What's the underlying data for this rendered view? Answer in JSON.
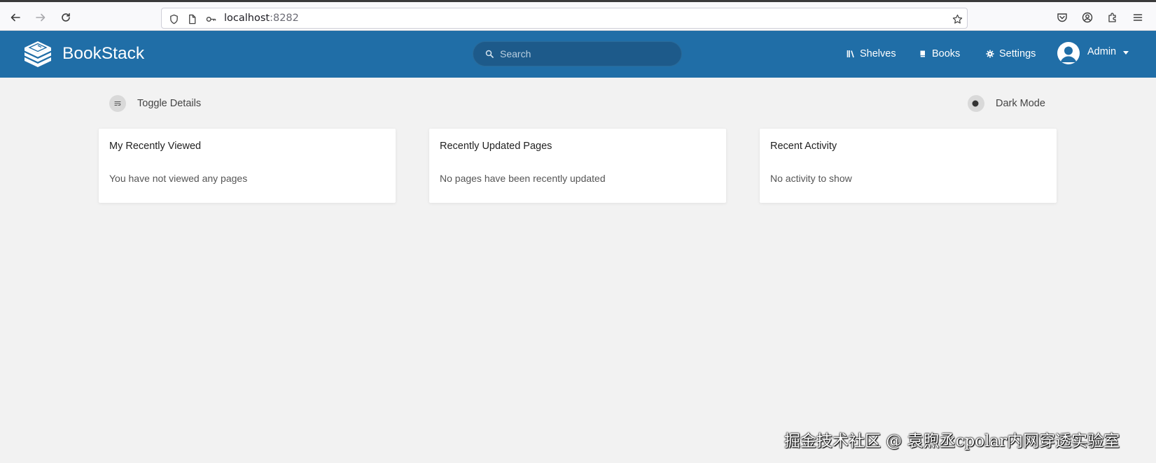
{
  "browser": {
    "url_host": "localhost",
    "url_port": ":8282"
  },
  "app": {
    "name": "BookStack",
    "brand_color": "#206ea7",
    "search": {
      "placeholder": "Search"
    },
    "nav": {
      "shelves": "Shelves",
      "books": "Books",
      "settings": "Settings"
    },
    "user": {
      "name": "Admin"
    }
  },
  "actions": {
    "toggle_details": "Toggle Details",
    "dark_mode": "Dark Mode"
  },
  "cards": [
    {
      "title": "My Recently Viewed",
      "body": "You have not viewed any pages"
    },
    {
      "title": "Recently Updated Pages",
      "body": "No pages have been recently updated"
    },
    {
      "title": "Recent Activity",
      "body": "No activity to show"
    }
  ],
  "watermark": "掘金技术社区 @ 袁煦丞cpolar内网穿透实验室"
}
